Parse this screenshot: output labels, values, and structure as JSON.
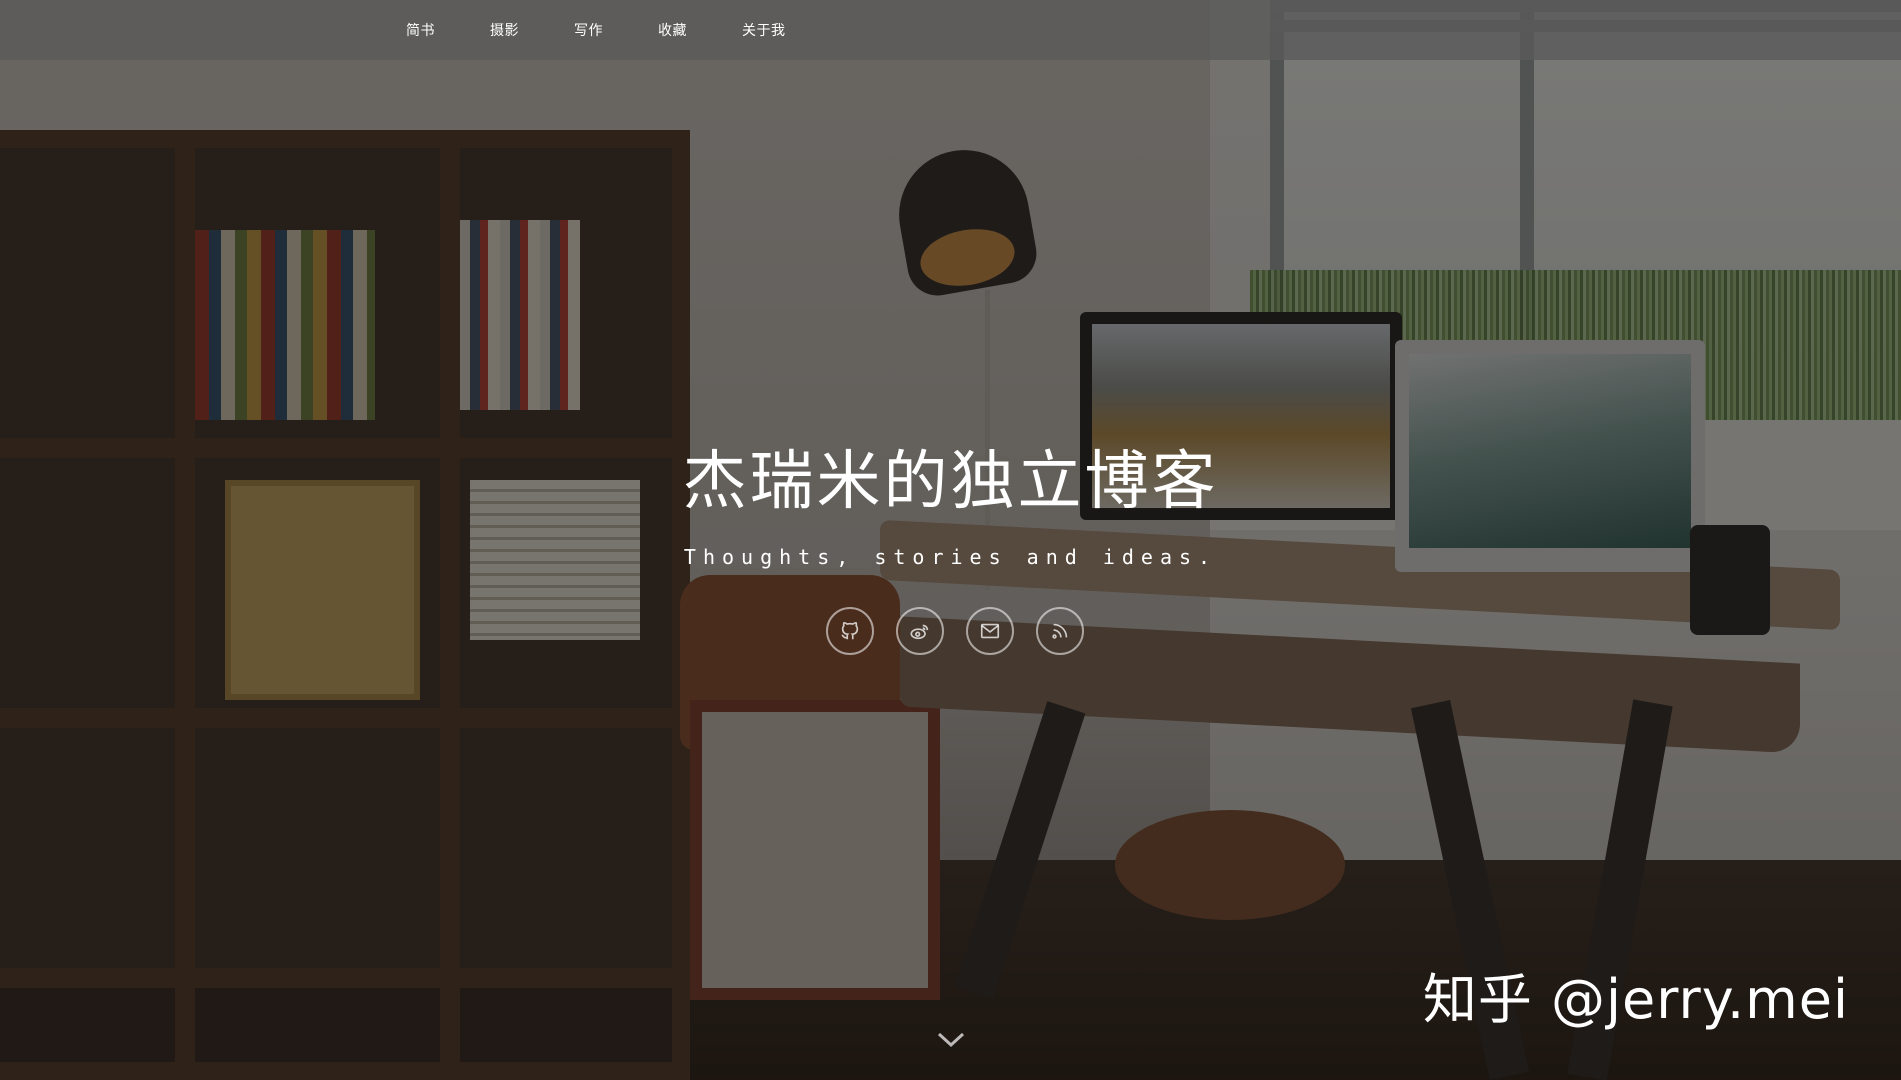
{
  "nav": {
    "items": [
      {
        "label": "简书",
        "name": "nav-item-jianshu"
      },
      {
        "label": "摄影",
        "name": "nav-item-photography"
      },
      {
        "label": "写作",
        "name": "nav-item-writing"
      },
      {
        "label": "收藏",
        "name": "nav-item-favorites"
      },
      {
        "label": "关于我",
        "name": "nav-item-about"
      }
    ]
  },
  "hero": {
    "title": "杰瑞米的独立博客",
    "subtitle": "Thoughts, stories and ideas."
  },
  "social": [
    {
      "icon": "github-icon"
    },
    {
      "icon": "weibo-icon"
    },
    {
      "icon": "mail-icon"
    },
    {
      "icon": "rss-icon"
    }
  ],
  "watermark": {
    "text": "知乎 @jerry.mei"
  },
  "scroll": {
    "icon": "chevron-down-icon"
  }
}
